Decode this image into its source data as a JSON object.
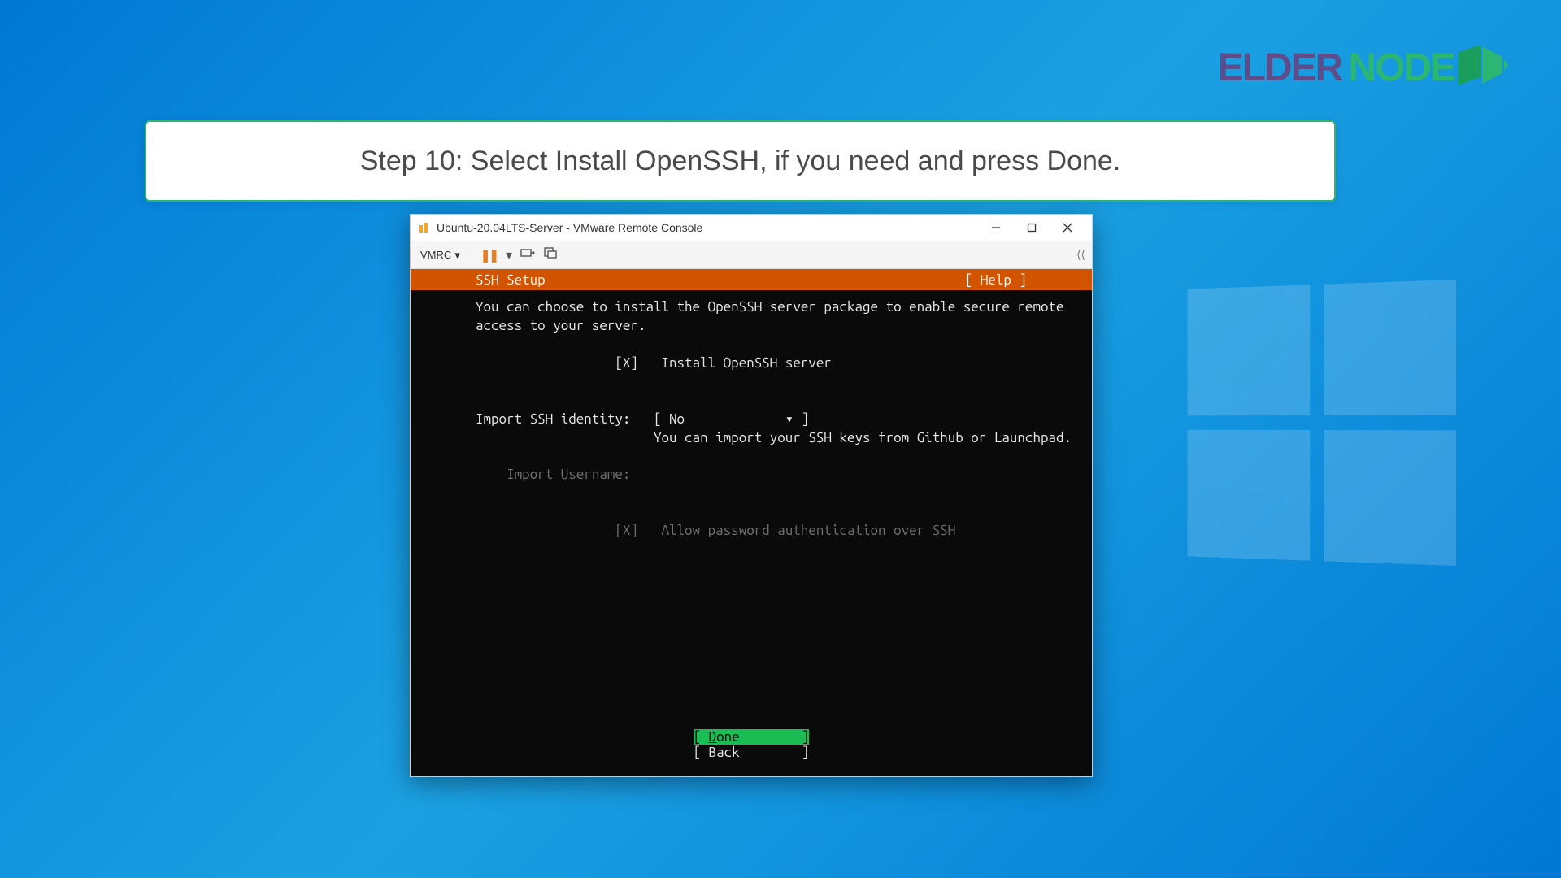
{
  "brand": {
    "left": "ELDER",
    "right": "NODE"
  },
  "instruction": "Step 10: Select Install OpenSSH, if you need and press Done.",
  "window": {
    "title": "Ubuntu-20.04LTS-Server - VMware Remote Console",
    "menu_label": "VMRC"
  },
  "terminal": {
    "header_title": "SSH Setup",
    "help_label": "[ Help ]",
    "description": "You can choose to install the OpenSSH server package to enable secure remote\naccess to your server.",
    "install_checkbox": "[X]",
    "install_label": "Install OpenSSH server",
    "identity_label": "Import SSH identity:",
    "identity_value": "[ No             ▾ ]",
    "identity_hint": "You can import your SSH keys from Github or Launchpad.",
    "import_username_label": "Import Username:",
    "allow_checkbox": "[X]",
    "allow_label": "Allow password authentication over SSH",
    "done_button": "[ Done        ]",
    "back_button": "[ Back        ]",
    "done_inner": "D",
    "done_rest": "one"
  }
}
